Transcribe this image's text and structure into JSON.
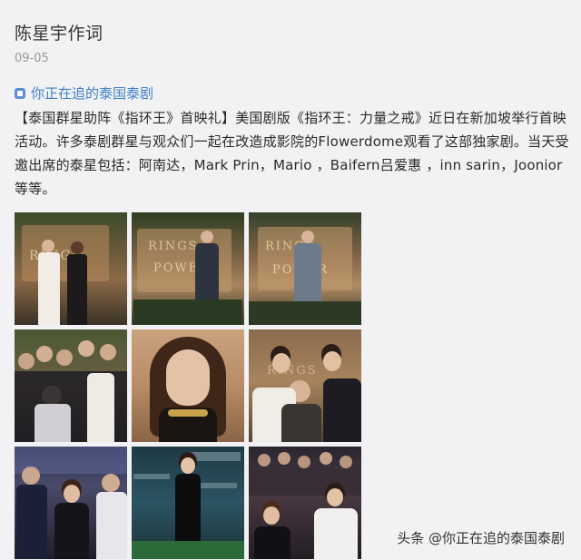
{
  "post": {
    "author": "陈星宇作词",
    "date": "09-05",
    "topic": "你正在追的泰国泰剧",
    "content": "【泰国群星助阵《指环王》首映礼】美国剧版《指环王：力量之戒》近日在新加坡举行首映活动。许多泰剧群星与观众们一起在改造成影院的Flowerdome观看了这部独家剧。当天受邀出席的泰星包括：阿南达，Mark Prin，Mario ，Baifern吕爱惠 ，inn sarin，Joonior等等。"
  },
  "photos": [
    {
      "alt": "photo-1"
    },
    {
      "alt": "photo-2"
    },
    {
      "alt": "photo-3"
    },
    {
      "alt": "photo-4"
    },
    {
      "alt": "photo-5"
    },
    {
      "alt": "photo-6"
    },
    {
      "alt": "photo-7"
    },
    {
      "alt": "photo-8"
    },
    {
      "alt": "photo-9"
    }
  ],
  "backdrop_text": {
    "rings": "RINGS",
    "power": "POWER"
  },
  "watermark": "头条 @你正在追的泰国泰剧",
  "colors": {
    "link": "#3d7fc9",
    "background": "#f2f2f4"
  }
}
